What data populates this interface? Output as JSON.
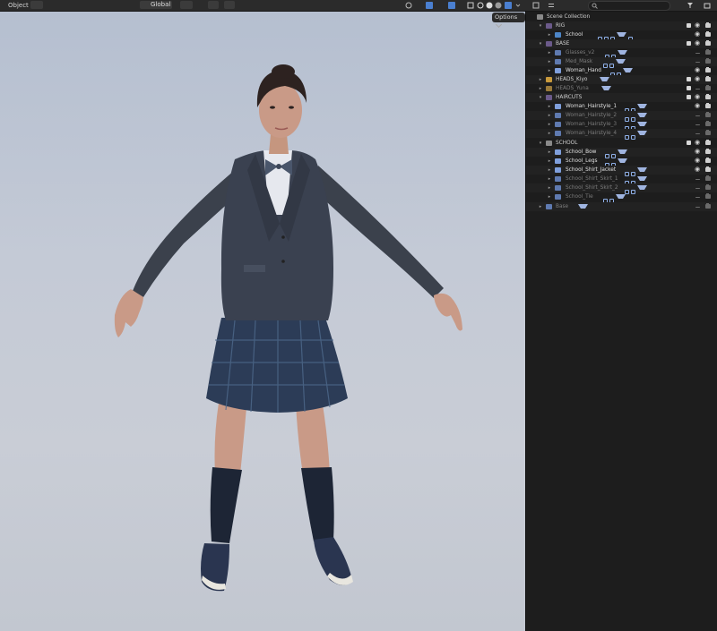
{
  "header": {
    "mode": "Object",
    "orientation": "Global",
    "options": "Options"
  },
  "outliner": {
    "title": "Scene Collection",
    "rows": [
      {
        "label": "RIG",
        "kind": "collection"
      },
      {
        "label": "School",
        "kind": "armature"
      },
      {
        "label": "BASE",
        "kind": "collection"
      },
      {
        "label": "Glasses_v2",
        "kind": "mesh"
      },
      {
        "label": "Med_Mask",
        "kind": "mesh"
      },
      {
        "label": "Woman_Hand",
        "kind": "mesh"
      },
      {
        "label": "HEADS_Kiyo",
        "kind": "collection"
      },
      {
        "label": "HEADS_Yuna",
        "kind": "collection"
      },
      {
        "label": "HAIRCUTS",
        "kind": "collection"
      },
      {
        "label": "Woman_Hairstyle_1",
        "kind": "mesh"
      },
      {
        "label": "Woman_Hairstyle_2",
        "kind": "mesh"
      },
      {
        "label": "Woman_Hairstyle_3",
        "kind": "mesh"
      },
      {
        "label": "Woman_Hairstyle_4",
        "kind": "mesh"
      },
      {
        "label": "SCHOOL",
        "kind": "collection"
      },
      {
        "label": "School_Bow",
        "kind": "mesh"
      },
      {
        "label": "School_Legs",
        "kind": "mesh"
      },
      {
        "label": "School_Shirt_Jacket",
        "kind": "mesh"
      },
      {
        "label": "School_Shirt_Skirt_1",
        "kind": "mesh"
      },
      {
        "label": "School_Shirt_Skirt_2",
        "kind": "mesh"
      },
      {
        "label": "School_Tie",
        "kind": "mesh"
      },
      {
        "label": "Base",
        "kind": "mesh"
      }
    ]
  },
  "colors": {
    "collection_icon": "#6b5a8a",
    "mesh_icon": "#7f9fdc",
    "armature_icon": "#4d86c8",
    "head_kiyo_icon": "#c99a3c",
    "head_yuna_icon": "#9a7a3a"
  }
}
